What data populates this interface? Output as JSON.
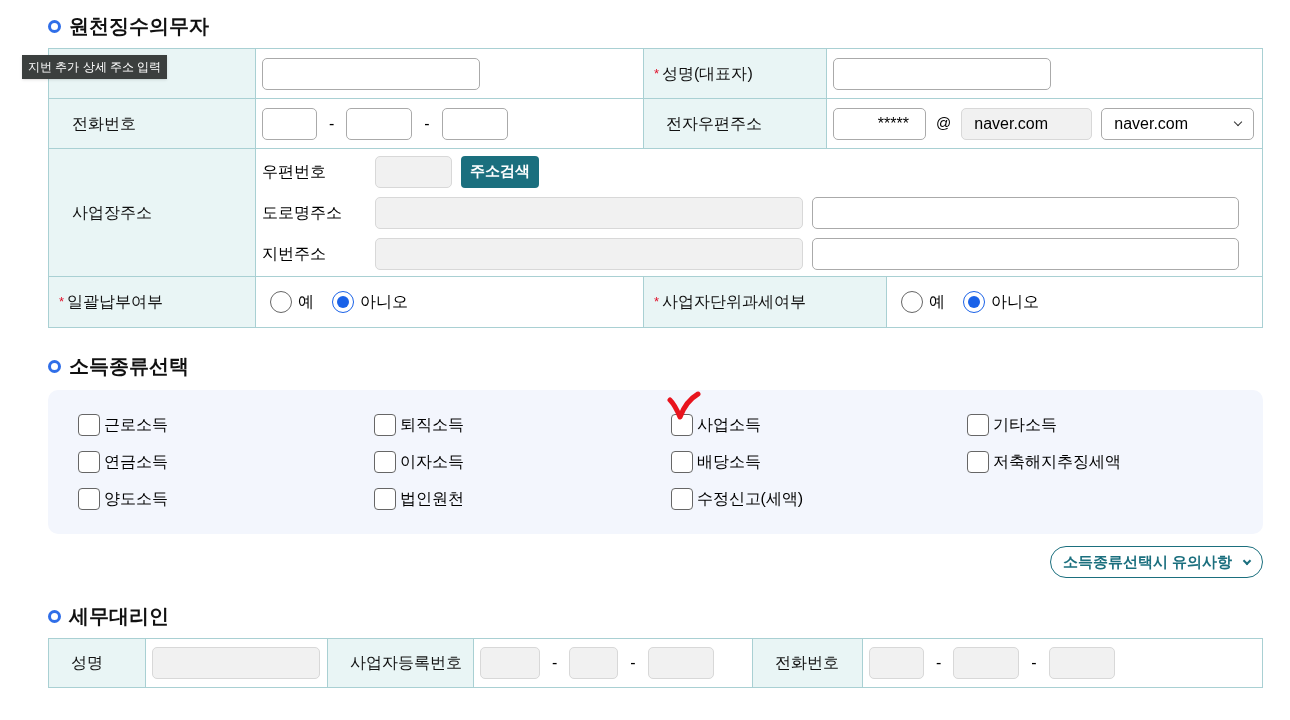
{
  "tooltip": "지번 추가 상세 주소 입력",
  "withholder": {
    "title": "원천징수의무자",
    "name": {
      "label": "성명(대표자)",
      "mark": "*"
    },
    "phone": {
      "label": "전화번호",
      "separators": [
        "-",
        "-"
      ]
    },
    "email": {
      "label": "전자우편주소",
      "local": "*****",
      "at": "@",
      "domain": "naver.com",
      "select": "naver.com"
    },
    "address": {
      "label": "사업장주소",
      "zip_label": "우편번호",
      "search_button": "주소검색",
      "road_label": "도로명주소",
      "lot_label": "지번주소"
    },
    "radios": [
      {
        "label": "일괄납부여부",
        "mark": "*",
        "options": [
          {
            "label": "예",
            "selected": false
          },
          {
            "label": "아니오",
            "selected": true
          }
        ]
      },
      {
        "label": "사업자단위과세여부",
        "mark": "*",
        "options": [
          {
            "label": "예",
            "selected": false
          },
          {
            "label": "아니오",
            "selected": true
          }
        ]
      }
    ]
  },
  "income": {
    "title": "소득종류선택",
    "items": [
      {
        "label": "근로소득",
        "checked": false,
        "marked": false
      },
      {
        "label": "퇴직소득",
        "checked": false,
        "marked": false
      },
      {
        "label": "사업소득",
        "checked": false,
        "marked": true
      },
      {
        "label": "기타소득",
        "checked": false,
        "marked": false
      },
      {
        "label": "연금소득",
        "checked": false,
        "marked": false
      },
      {
        "label": "이자소득",
        "checked": false,
        "marked": false
      },
      {
        "label": "배당소득",
        "checked": false,
        "marked": false
      },
      {
        "label": "저축해지추징세액",
        "checked": false,
        "marked": false
      },
      {
        "label": "양도소득",
        "checked": false,
        "marked": false
      },
      {
        "label": "법인원천",
        "checked": false,
        "marked": false
      },
      {
        "label": "수정신고(세액)",
        "checked": false,
        "marked": false
      }
    ],
    "notice_button": "소득종류선택시 유의사항"
  },
  "agent": {
    "title": "세무대리인",
    "name_label": "성명",
    "reg_label": "사업자등록번호",
    "reg_separators": [
      "-",
      "-"
    ],
    "phone_label": "전화번호",
    "phone_separators": [
      "-",
      "-"
    ]
  }
}
